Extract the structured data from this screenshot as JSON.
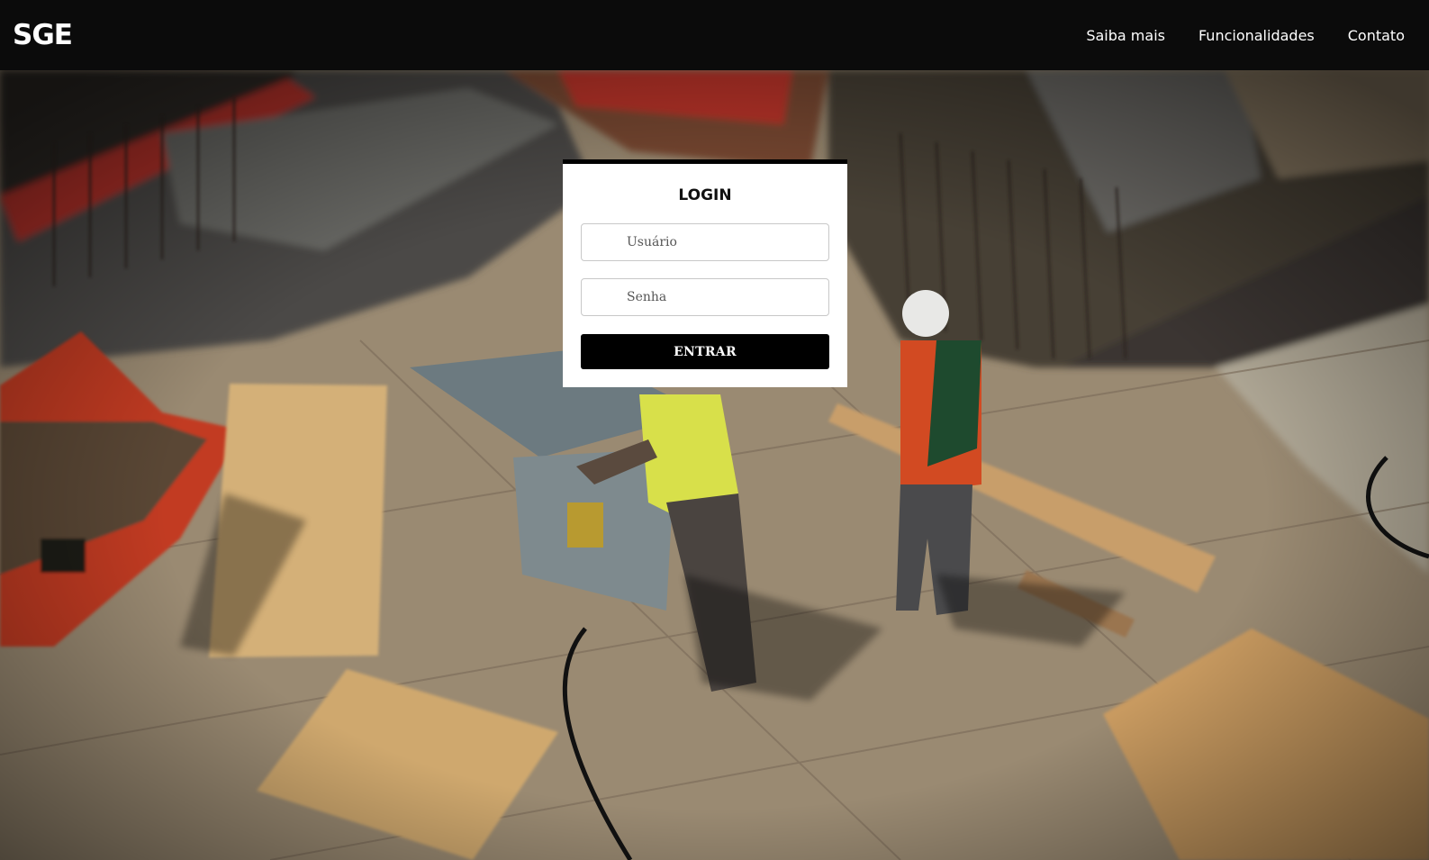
{
  "header": {
    "brand": "SGE",
    "nav": [
      {
        "label": "Saiba mais"
      },
      {
        "label": "Funcionalidades"
      },
      {
        "label": "Contato"
      }
    ]
  },
  "login": {
    "title": "LOGIN",
    "username_placeholder": "Usuário",
    "password_placeholder": "Senha",
    "submit_label": "ENTRAR"
  },
  "colors": {
    "navbar": "#0b0b0b",
    "button": "#000000",
    "card": "#ffffff"
  }
}
